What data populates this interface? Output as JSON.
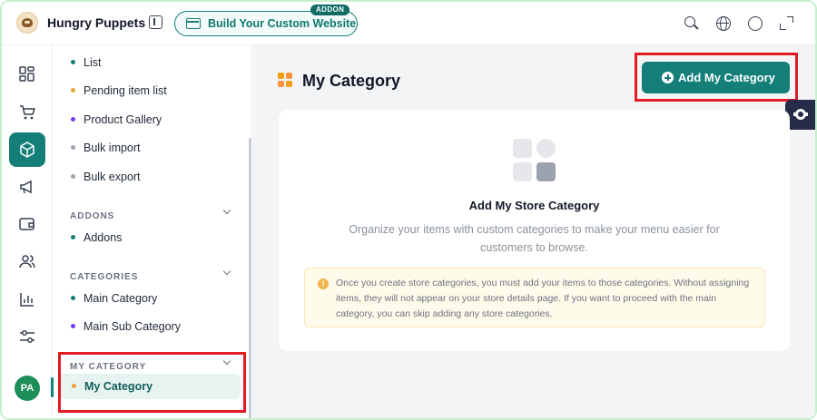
{
  "header": {
    "brand": "Hungry Puppets",
    "build_button_label": "Build Your Custom Website",
    "addon_badge": "ADDON",
    "icons": [
      "sidebar-toggle-icon",
      "search-icon",
      "globe-icon",
      "chat-icon",
      "expand-icon"
    ]
  },
  "rail": {
    "items": [
      "dashboard-icon",
      "cart-icon",
      "box-icon",
      "megaphone-icon",
      "wallet-icon",
      "users-icon",
      "chart-icon",
      "settings-sliders-icon"
    ],
    "active": "box-icon",
    "avatar_initials": "PA"
  },
  "sidebar": {
    "items_top": [
      {
        "label": "List",
        "dot": "#147f79"
      },
      {
        "label": "Pending item list",
        "dot": "#e8a33d"
      },
      {
        "label": "Product Gallery",
        "dot": "#7c3aed"
      },
      {
        "label": "Bulk import",
        "dot": "#9ca3af"
      },
      {
        "label": "Bulk export",
        "dot": "#9ca3af"
      }
    ],
    "addons_head": "ADDONS",
    "addons_items": [
      {
        "label": "Addons",
        "dot": "#147f79"
      }
    ],
    "categories_head": "CATEGORIES",
    "categories_items": [
      {
        "label": "Main Category",
        "dot": "#147f79"
      },
      {
        "label": "Main Sub Category",
        "dot": "#7c3aed"
      }
    ],
    "mycategory_head": "MY CATEGORY",
    "mycategory_item": "My Category"
  },
  "main": {
    "title": "My Category",
    "add_button": "Add My Category",
    "empty_title": "Add My Store Category",
    "empty_desc": "Organize your items with custom categories to make your menu easier for customers to browse.",
    "notice": "Once you create store categories, you must add your items to those categories. Without assigning items, they will not appear on your store details page. If you want to proceed with the main category, you can skip adding any store categories."
  },
  "colors": {
    "primary": "#147f79",
    "highlight": "#e01b24",
    "notice_bg": "#fffbeb"
  }
}
